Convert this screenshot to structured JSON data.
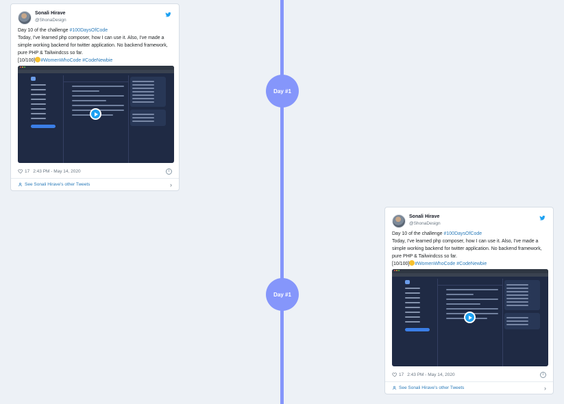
{
  "timeline": {
    "markers": [
      {
        "label": "Day #1"
      },
      {
        "label": "Day #1"
      }
    ]
  },
  "tweets": [
    {
      "author_name": "Sonali Hirave",
      "author_handle": "@ShonaDesign",
      "line1_prefix": "Day 10 of the challenge ",
      "line1_link": "#100DaysOfCode",
      "body": "Today, I've learned php composer, how I can use it. Also, I've made a simple working backend for twitter application. No backend framework, pure PHP & Tailwindcss so far.",
      "counter": "[10/100]",
      "tag1": "#WomenWhoCode",
      "tag2": "#CodeNewbie",
      "likes": "17",
      "timestamp": "2:43 PM - May 14, 2020",
      "footer_link": "See Sonali Hirave's other Tweets"
    },
    {
      "author_name": "Sonali Hirave",
      "author_handle": "@ShonaDesign",
      "line1_prefix": "Day 10 of the challenge ",
      "line1_link": "#100DaysOfCode",
      "body": "Today, I've learned php composer, how I can use it. Also, I've made a simple working backend for twitter application. No backend framework, pure PHP & Tailwindcss so far.",
      "counter": "[10/100]",
      "tag1": "#WomenWhoCode",
      "tag2": "#CodeNewbie",
      "likes": "17",
      "timestamp": "2:43 PM - May 14, 2020",
      "footer_link": "See Sonali Hirave's other Tweets"
    }
  ],
  "colors": {
    "background": "#edf1f6",
    "timeline": "#8596fb",
    "link": "#2b7bb9",
    "twitter_blue": "#1da1f2"
  },
  "icons": [
    "twitter-bird-icon",
    "heart-icon",
    "info-icon",
    "person-icon",
    "chevron-right-icon",
    "play-icon"
  ]
}
